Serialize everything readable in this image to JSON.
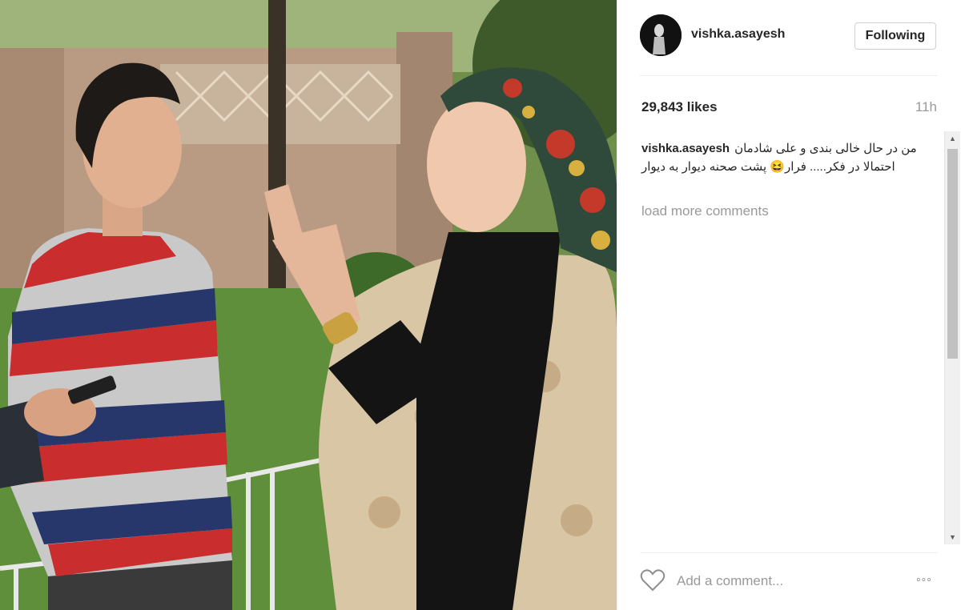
{
  "post": {
    "username": "vishka.asayesh",
    "follow_label": "Following",
    "likes": "29,843 likes",
    "time": "11h",
    "caption_user": "vishka.asayesh",
    "caption_text": "من در حال خالی بندی و علی شادمان احتمالا در فکر..... فرار😆 پشت صحنه دیوار به دیوار",
    "load_more": "load more comments",
    "comment_placeholder": "Add a comment...",
    "more_label": "◦◦◦"
  },
  "icons": {
    "avatar": "avatar-photo",
    "like": "heart-icon",
    "more": "more-options-icon",
    "scroll_up": "chevron-up-icon",
    "scroll_down": "chevron-down-icon"
  },
  "colors": {
    "username": "#262626",
    "muted": "#999999",
    "divider": "#efefef"
  }
}
